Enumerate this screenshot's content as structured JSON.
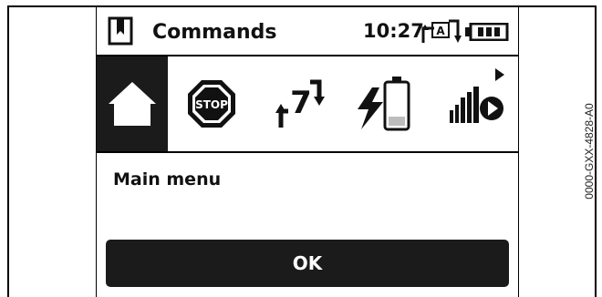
{
  "header": {
    "title": "Commands",
    "clock": "10:27",
    "auto_mode_letter": "A",
    "book_icon": "book-icon",
    "battery_icon": "battery-icon",
    "mode_icon": "auto-mode-icon"
  },
  "commands": {
    "items": [
      {
        "name": "home",
        "icon": "home-icon",
        "selected": true
      },
      {
        "name": "stop",
        "icon": "stop-icon",
        "label": "STOP",
        "selected": false
      },
      {
        "name": "schedule",
        "icon": "schedule-7-icon",
        "label": "7",
        "selected": false
      },
      {
        "name": "charge",
        "icon": "charging-icon",
        "selected": false
      },
      {
        "name": "signal",
        "icon": "signal-play-icon",
        "selected": false
      }
    ],
    "more_icon": "arrow-right-icon"
  },
  "main": {
    "label": "Main menu"
  },
  "footer": {
    "ok_label": "OK"
  },
  "figure_code": "0000-GXX-4828-A0",
  "colors": {
    "foreground": "#111111",
    "selected_background": "#1b1b1b",
    "background": "#ffffff"
  }
}
